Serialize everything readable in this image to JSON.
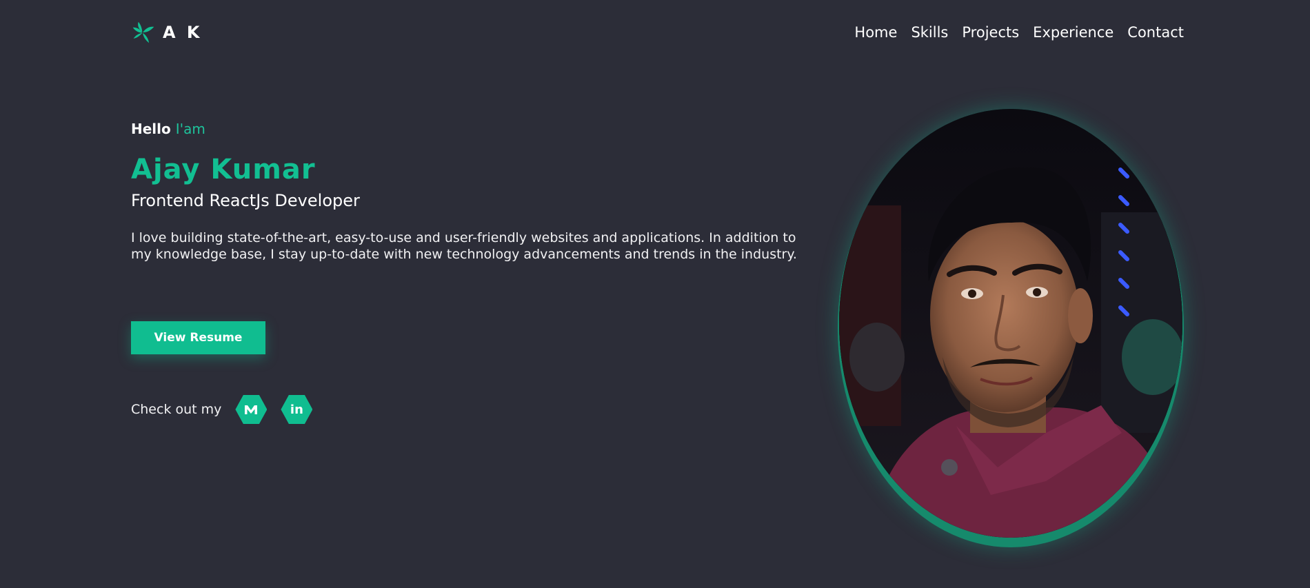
{
  "brand": {
    "text": "A K",
    "icon": "leaf-logo-icon",
    "color": "#12bf92"
  },
  "nav": {
    "items": [
      {
        "label": "Home"
      },
      {
        "label": "Skills"
      },
      {
        "label": "Projects"
      },
      {
        "label": "Experience"
      },
      {
        "label": "Contact"
      }
    ]
  },
  "hero": {
    "greeting": "Hello",
    "greeting_accent": "I'am",
    "name": "Ajay Kumar",
    "role": "Frontend ReactJs Developer",
    "bio": "I love building state-of-the-art, easy-to-use and user-friendly websites and applications. In addition to my knowledge base, I stay up-to-date with new technology advancements and trends in the industry.",
    "resume_button": "View Resume",
    "social_label": "Check out my",
    "social": [
      {
        "icon": "medium-icon"
      },
      {
        "icon": "linkedin-icon",
        "glyph": "in"
      }
    ]
  },
  "portrait": {
    "icon": "profile-photo"
  },
  "colors": {
    "background": "#2c2d38",
    "accent": "#12bf92",
    "button": "#10bd90",
    "text": "#ffffff"
  }
}
